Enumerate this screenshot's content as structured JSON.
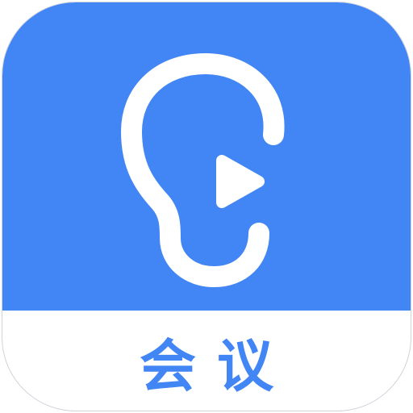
{
  "app_icon": {
    "label": "会议",
    "colors": {
      "accent": "#4285f4",
      "background": "#ffffff",
      "glyph": "#ffffff"
    },
    "icons": [
      "ear-icon",
      "play-icon"
    ]
  }
}
